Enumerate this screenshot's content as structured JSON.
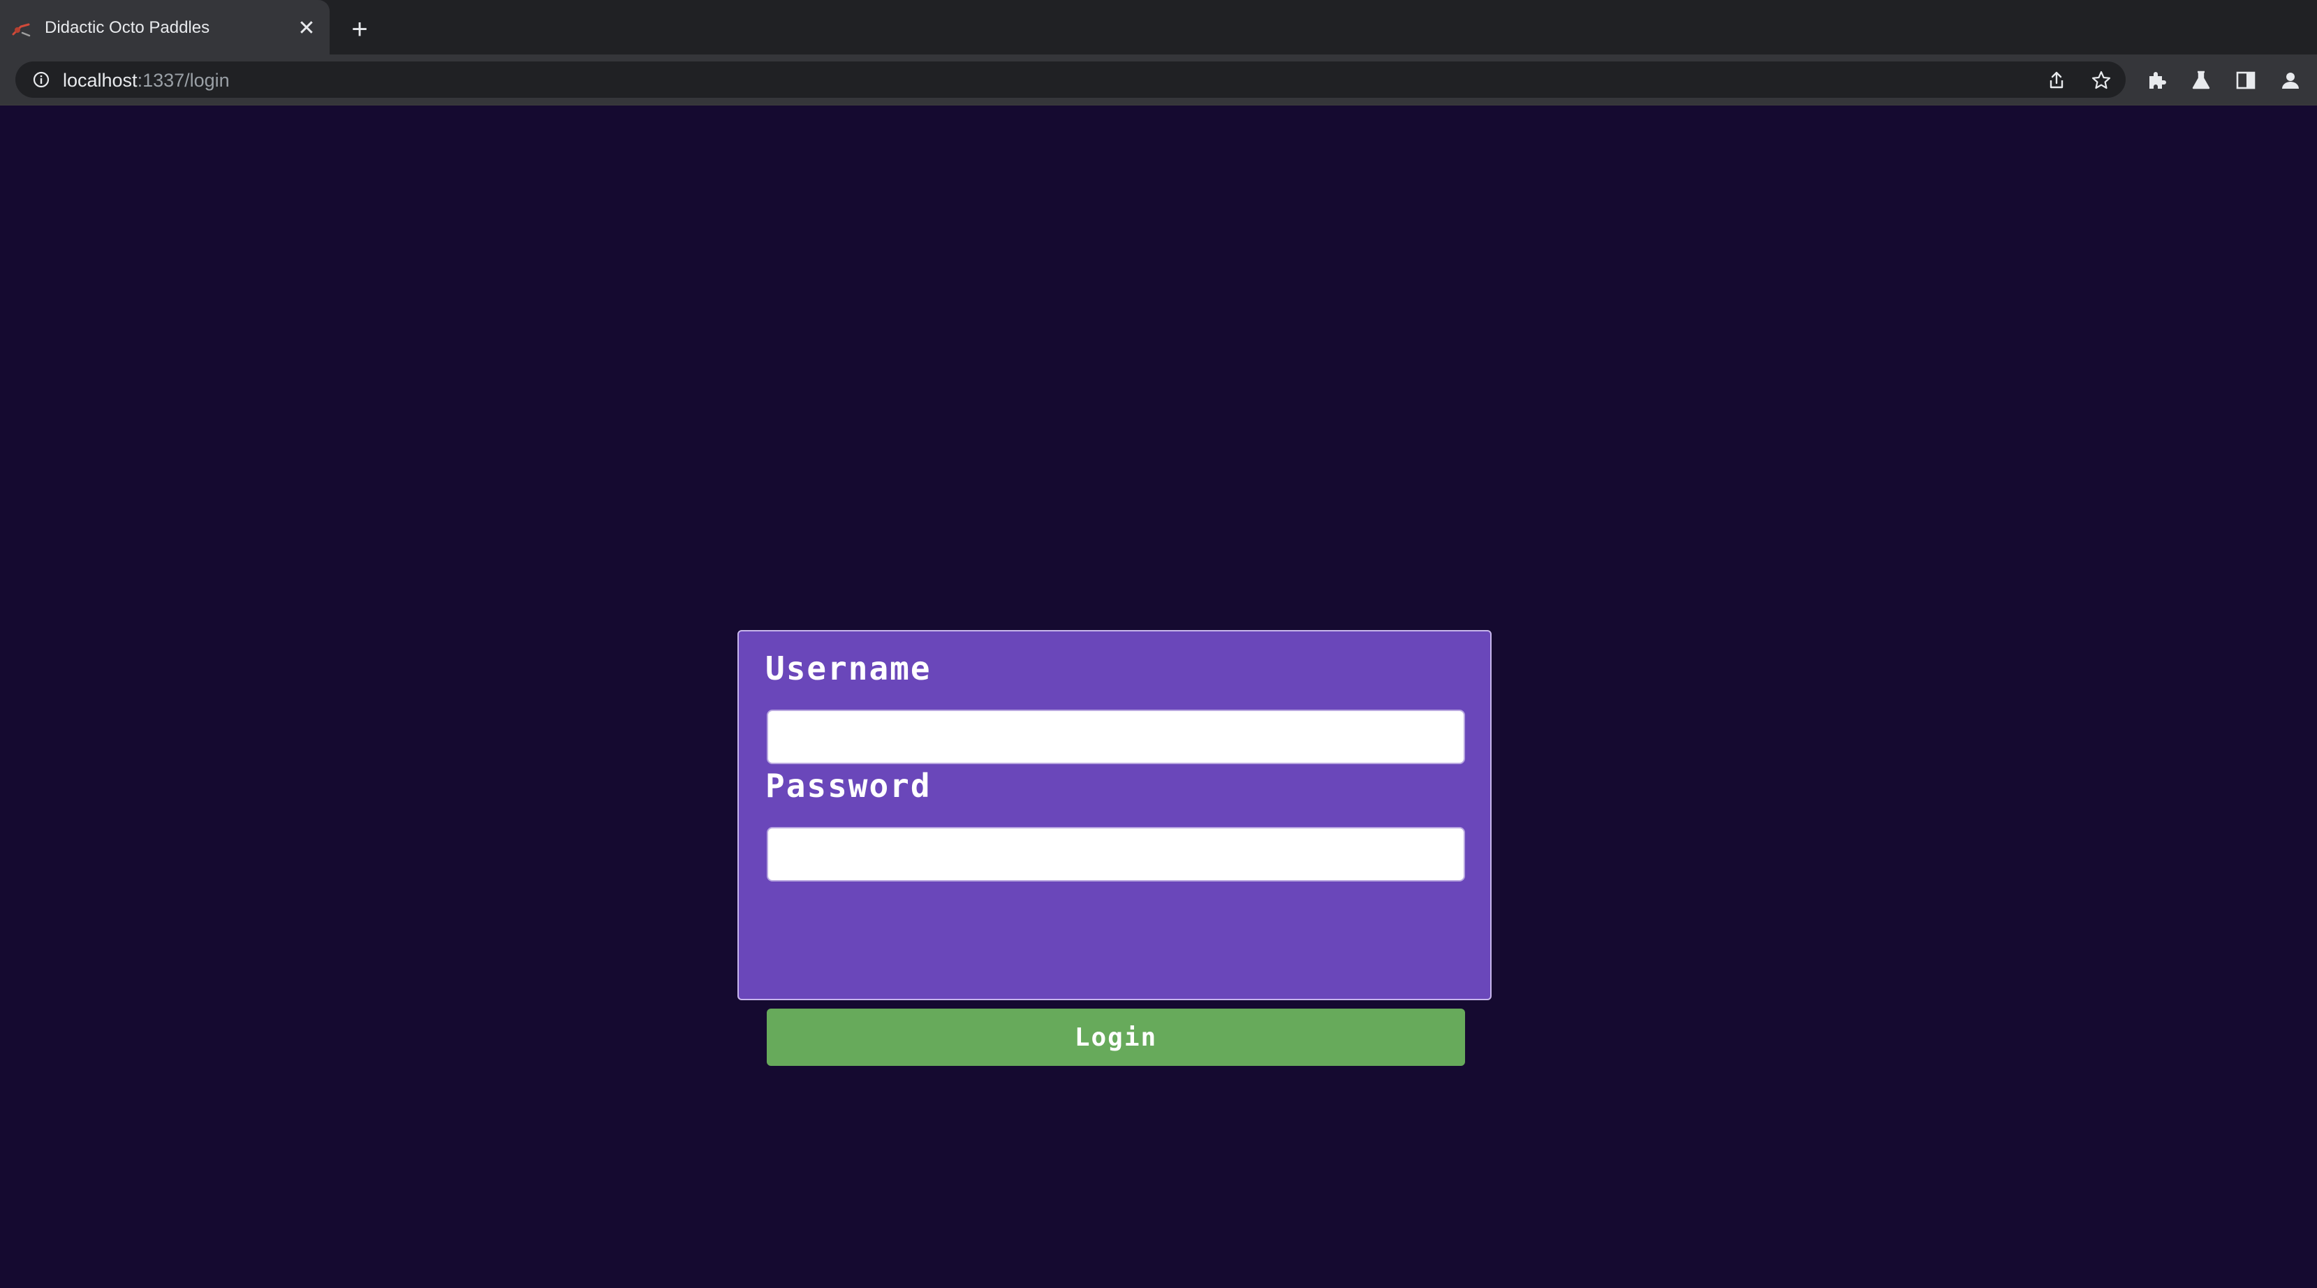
{
  "browser": {
    "tab_title": "Didactic Octo Paddles",
    "close_glyph": "✕",
    "new_tab_glyph": "+",
    "url_host": "localhost",
    "url_path": ":1337/login",
    "icons": [
      "favicon-icon",
      "info-icon",
      "share-icon",
      "star-icon",
      "extensions-icon",
      "labs-icon",
      "side-panel-icon",
      "profile-icon"
    ]
  },
  "login": {
    "username_label": "Username",
    "username_value": "",
    "password_label": "Password",
    "password_value": "",
    "submit_label": "Login"
  },
  "colors": {
    "page_background": "#150a30",
    "card_background": "#6a47ba",
    "button_background": "#67aa5b",
    "label_text": "#ffffff"
  }
}
